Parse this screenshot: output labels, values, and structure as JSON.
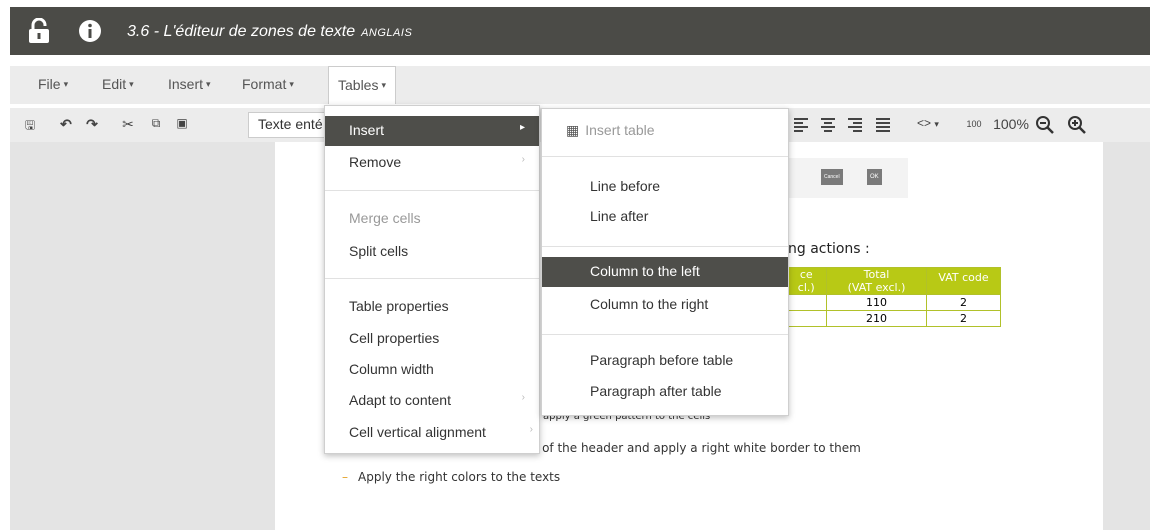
{
  "title": {
    "main": "3.6 - L'éditeur de zones de texte",
    "sub": "ANGLAIS"
  },
  "icons": {
    "lock": "lock-icon",
    "info": "info-icon"
  },
  "menubar": {
    "items": [
      {
        "label": "File"
      },
      {
        "label": "Edit"
      },
      {
        "label": "Insert"
      },
      {
        "label": "Format"
      },
      {
        "label": "Tables"
      }
    ]
  },
  "toolbar": {
    "style_value": "Texte enté",
    "zoom_label": "100%",
    "hundred_label": "100",
    "code_label": "<>"
  },
  "tables_menu": {
    "items": [
      {
        "label": "Insert",
        "highlighted": true,
        "submenu": true
      },
      {
        "label": "Remove",
        "submenu": true
      },
      {
        "label": "Merge cells",
        "disabled": true
      },
      {
        "label": "Split cells"
      },
      {
        "label": "Table properties"
      },
      {
        "label": "Cell properties"
      },
      {
        "label": "Column width"
      },
      {
        "label": "Adapt to content",
        "submenu": true
      },
      {
        "label": "Cell vertical alignment",
        "submenu": true
      }
    ]
  },
  "insert_submenu": {
    "items": [
      {
        "label": "Insert table",
        "disabled": true
      },
      {
        "label": "Line before"
      },
      {
        "label": "Line after"
      },
      {
        "label": "Column to the left",
        "highlighted": true
      },
      {
        "label": "Column to the right"
      },
      {
        "label": "Paragraph before table"
      },
      {
        "label": "Paragraph after table"
      }
    ]
  },
  "document": {
    "dialog": {
      "cancel": "Cancel",
      "ok": "OK"
    },
    "actions_heading": "ng actions :",
    "table": {
      "headers": [
        {
          "line1": "ce",
          "line2": "cl.)"
        },
        {
          "line1": "Total",
          "line2": "(VAT excl.)"
        },
        {
          "line1": "VAT code",
          "line2": ""
        }
      ],
      "rows": [
        [
          "",
          "110",
          "2"
        ],
        [
          "",
          "210",
          "2"
        ]
      ]
    },
    "bullets": [
      "apply a green pattern to the cells",
      "s of the header and apply a right white border to them",
      "Apply the right colors to the texts"
    ]
  },
  "colors": {
    "titlebar": "#4b4b47",
    "menu_highlight": "#4e4e4a",
    "table_header": "#b8c915",
    "bullet_dash": "#e3a126"
  }
}
